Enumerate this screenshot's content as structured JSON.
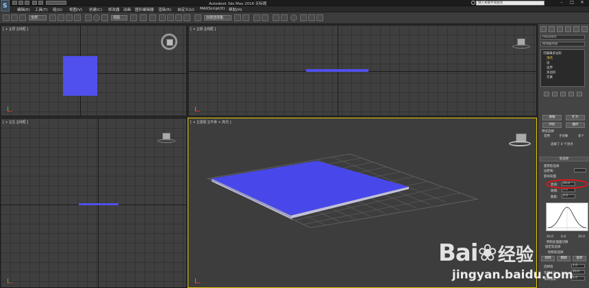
{
  "app": {
    "title": "Autodesk 3ds Max 2016  无标题",
    "search_placeholder": "键入关键字或短语"
  },
  "menubar": {
    "items": [
      "编辑(E)",
      "工具(T)",
      "组(G)",
      "视图(V)",
      "创建(C)",
      "修改器",
      "动画",
      "图形编辑器",
      "渲染(R)",
      "自定义(U)",
      "MAXScript(X)",
      "帮助(H)"
    ]
  },
  "toolbar": {
    "selection_filter": "全部",
    "view_dropdown": "视图",
    "selection_set": "创建选择集"
  },
  "viewports": {
    "top": "[ + ][顶 ][线框 ]",
    "front": "[ + ][前 ][线框 ]",
    "left": "[ + ][左 ][线框 ]",
    "perspective": "[ + ][透视 ][平滑 + 高光 ]"
  },
  "command_panel": {
    "object_name": "Plane001",
    "modifier_list": "修改器列表",
    "stack": {
      "root": "可编辑多边形",
      "items": [
        "顶点",
        "边",
        "边界",
        "多边形",
        "元素"
      ]
    },
    "selection": {
      "ring_label": "收缩",
      "grow_label": "扩大",
      "loop_label": "环形",
      "loop2_label": "循环",
      "preview_label": "预览选择",
      "off_label": "禁用",
      "subobj_label": "子对象",
      "multi_label": "多个",
      "status": "选择了 0 个顶点"
    },
    "soft_selection": {
      "header": "软选择",
      "use_soft": "使用软选择",
      "edge_distance": "边距离:",
      "affect_backfacing": "影响背面",
      "falloff_label": "衰减:",
      "falloff_value": "20.0",
      "pinch_label": "收缩:",
      "pinch_value": "0.0",
      "bubble_label": "膨胀:",
      "bubble_value": "0.0",
      "curve_ticks": [
        "20.0",
        "0.0",
        "20.0"
      ],
      "shade_face": "明暗处理面切换",
      "lock_soft": "锁定软选择",
      "paint_header": "绘制软选择",
      "paint_label": "绘制",
      "blur_label": "模糊",
      "revert_label": "复原",
      "select_value": "选择值",
      "select_value_num": "1.0",
      "brush_size": "笔刷大小",
      "brush_size_num": "20.0",
      "brush_strength": "笔刷强度",
      "brush_strength_num": "1.0"
    }
  },
  "watermark": {
    "brand": "Bai",
    "brand2": "经验",
    "url": "jingyan.baidu.com"
  }
}
